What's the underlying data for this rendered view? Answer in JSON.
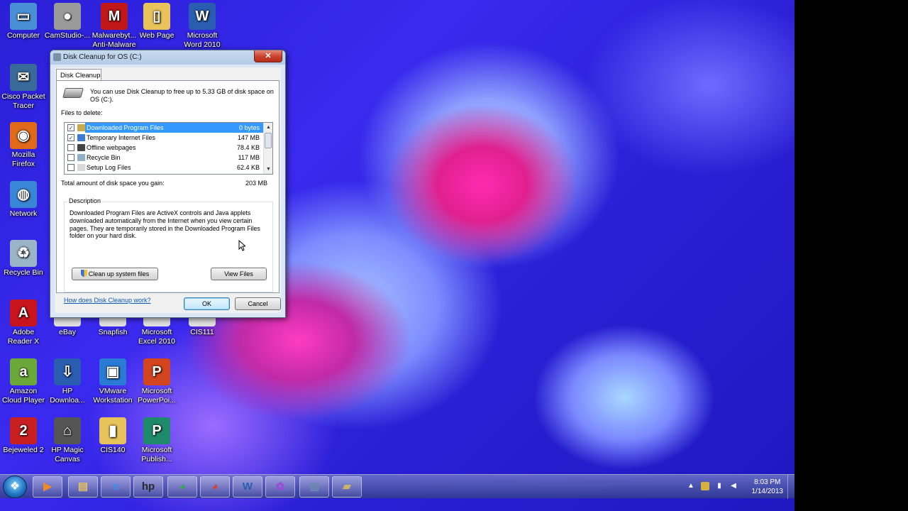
{
  "desktop_icons": [
    {
      "label": "Computer",
      "color": "#4a8fd6",
      "glyph": "▭"
    },
    {
      "label": "CamStudio-...",
      "color": "#9a9a9a",
      "glyph": "●"
    },
    {
      "label": "Malwarebyt...\nAnti-Malware",
      "color": "#c01818",
      "glyph": "M"
    },
    {
      "label": "Web Page",
      "color": "#e8c25a",
      "glyph": "▯"
    },
    {
      "label": "Microsoft\nWord 2010",
      "color": "#2a5db0",
      "glyph": "W"
    },
    {
      "label": "Cisco Packet\nTracer",
      "color": "#3a6a9a",
      "glyph": "✉"
    },
    {
      "label": "Mozilla\nFirefox",
      "color": "#e06a1a",
      "glyph": "◉"
    },
    {
      "label": "Network",
      "color": "#3a86d6",
      "glyph": "◍"
    },
    {
      "label": "Recycle Bin",
      "color": "#9ab4c8",
      "glyph": "♻"
    },
    {
      "label": "Adobe\nReader X",
      "color": "#c8141c",
      "glyph": "A"
    },
    {
      "label": "eBay",
      "color": "#e0e0e0",
      "glyph": ""
    },
    {
      "label": "Snapfish",
      "color": "#e0e0e0",
      "glyph": ""
    },
    {
      "label": "Microsoft\nExcel 2010",
      "color": "#e0e0e0",
      "glyph": ""
    },
    {
      "label": "CIS111",
      "color": "#e0e0e0",
      "glyph": ""
    },
    {
      "label": "Amazon\nCloud Player",
      "color": "#6aa83a",
      "glyph": "a"
    },
    {
      "label": "HP\nDownloa...",
      "color": "#2a5db0",
      "glyph": "⇩"
    },
    {
      "label": "VMware\nWorkstation",
      "color": "#2a7ad6",
      "glyph": "▣"
    },
    {
      "label": "Microsoft\nPowerPoi...",
      "color": "#d2451e",
      "glyph": "P"
    },
    {
      "label": "Bejeweled 2",
      "color": "#c82020",
      "glyph": "2"
    },
    {
      "label": "HP Magic\nCanvas",
      "color": "#555555",
      "glyph": "⌂"
    },
    {
      "label": "CIS140",
      "color": "#e8c25a",
      "glyph": "▮"
    },
    {
      "label": "Microsoft\nPublish...",
      "color": "#1e8a6a",
      "glyph": "P"
    }
  ],
  "dialog": {
    "title": "Disk Cleanup for OS (C:)",
    "close_glyph": "✕",
    "tab": "Disk Cleanup",
    "intro": "You can use Disk Cleanup to free up to 5.33 GB of disk space on OS (C:).",
    "files_label": "Files to delete:",
    "files": [
      {
        "name": "Downloaded Program Files",
        "size": "0 bytes",
        "checked": true,
        "selected": true,
        "icon_color": "#c9a94a"
      },
      {
        "name": "Temporary Internet Files",
        "size": "147 MB",
        "checked": true,
        "selected": false,
        "icon_color": "#3b7bd4"
      },
      {
        "name": "Offline webpages",
        "size": "78.4 KB",
        "checked": false,
        "selected": false,
        "icon_color": "#444444"
      },
      {
        "name": "Recycle Bin",
        "size": "117 MB",
        "checked": false,
        "selected": false,
        "icon_color": "#8fb0c8"
      },
      {
        "name": "Setup Log Files",
        "size": "62.4 KB",
        "checked": false,
        "selected": false,
        "icon_color": "#d9d9d9"
      }
    ],
    "total_label": "Total amount of disk space you gain:",
    "total_value": "203 MB",
    "description_legend": "Description",
    "description_text": "Downloaded Program Files are ActiveX controls and Java applets downloaded automatically from the Internet when you view certain pages. They are temporarily stored in the Downloaded Program Files folder on your hard disk.",
    "cleanup_system_label": "Clean up system files",
    "view_files_label": "View Files",
    "help_link": "How does Disk Cleanup work?",
    "ok_label": "OK",
    "cancel_label": "Cancel"
  },
  "taskbar": {
    "start_glyph": "❖",
    "pinned": [
      {
        "name": "media-player",
        "glyph": "▶",
        "color": "#f08a24"
      },
      {
        "name": "explorer",
        "glyph": "▤",
        "color": "#e8c25a"
      },
      {
        "name": "internet-explorer",
        "glyph": "e",
        "color": "#3a8ee6"
      },
      {
        "name": "hp",
        "glyph": "hp",
        "color": "#2a2a2a"
      },
      {
        "name": "chrome",
        "glyph": "◕",
        "color": "#2ea84a"
      },
      {
        "name": "chrome-2",
        "glyph": "◕",
        "color": "#d8402a"
      },
      {
        "name": "word",
        "glyph": "W",
        "color": "#2a5db0"
      },
      {
        "name": "picasa",
        "glyph": "✿",
        "color": "#9a4ad6"
      },
      {
        "name": "movie-maker",
        "glyph": "▥",
        "color": "#6a8ab0"
      },
      {
        "name": "disk-cleanup",
        "glyph": "▰",
        "color": "#c9b46a"
      }
    ],
    "clock_time": "8:03 PM",
    "clock_date": "1/14/2013"
  }
}
